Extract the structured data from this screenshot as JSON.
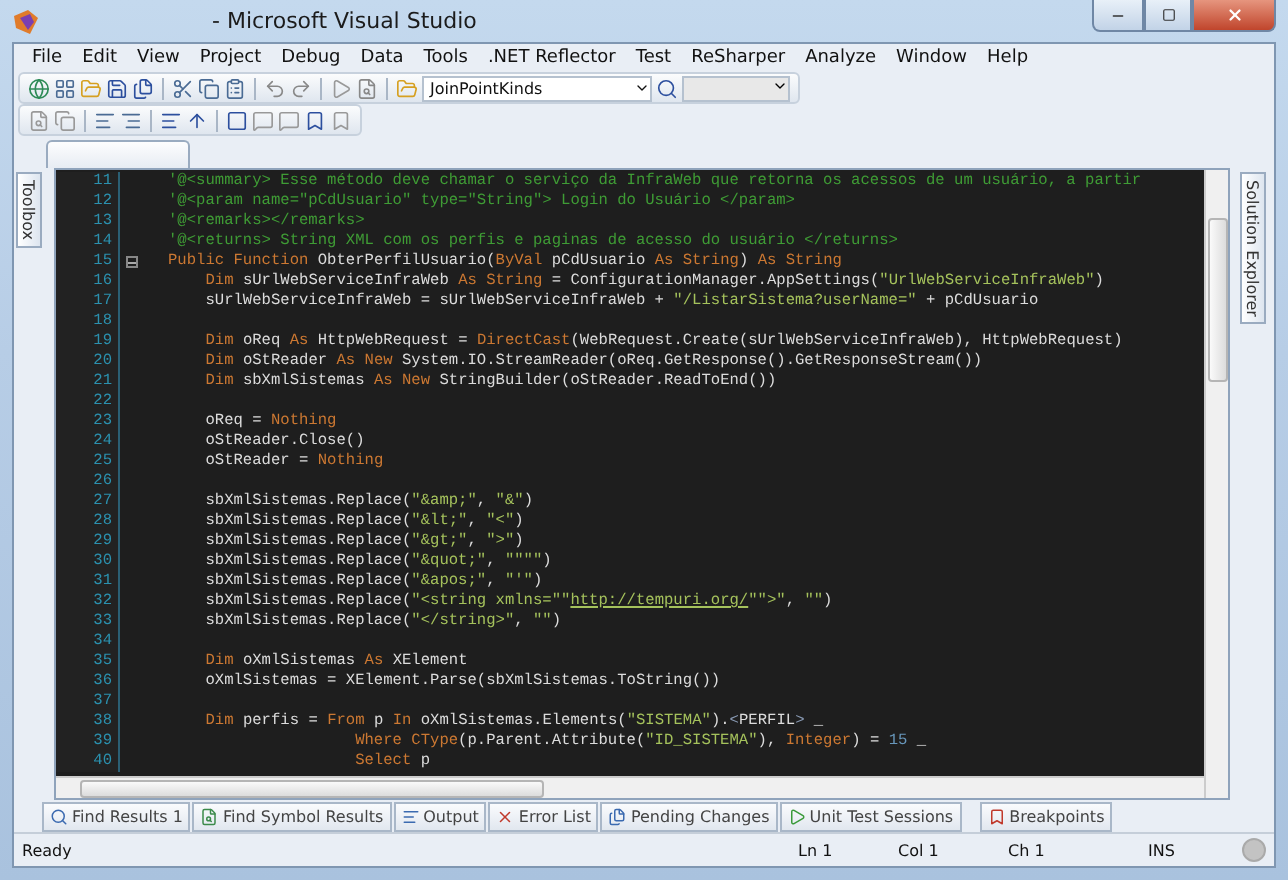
{
  "window": {
    "title": "- Microsoft Visual Studio"
  },
  "menu": [
    {
      "label": "File"
    },
    {
      "label": "Edit"
    },
    {
      "label": "View"
    },
    {
      "label": "Project"
    },
    {
      "label": "Debug"
    },
    {
      "label": "Data"
    },
    {
      "label": "Tools"
    },
    {
      "label": ".NET Reflector"
    },
    {
      "label": "Test"
    },
    {
      "label": "ReSharper"
    },
    {
      "label": "Analyze"
    },
    {
      "label": "Window"
    },
    {
      "label": "Help"
    }
  ],
  "toolbar": {
    "find_combo": {
      "value": "JoinPointKinds"
    }
  },
  "left_dock": {
    "label": "Toolbox"
  },
  "right_dock": {
    "label": "Solution Explorer"
  },
  "editor": {
    "lines": [
      {
        "number": "11",
        "fold": false,
        "tokens": [
          {
            "kind": "comment",
            "text": "'@<summary> Esse método deve chamar o serviço da InfraWeb que retorna os acessos de um usuário, a partir"
          }
        ]
      },
      {
        "number": "12",
        "fold": false,
        "tokens": [
          {
            "kind": "comment",
            "text": "'@<param name=\"pCdUsuario\" type=\"String\"> Login do Usuário </param>"
          }
        ]
      },
      {
        "number": "13",
        "fold": false,
        "tokens": [
          {
            "kind": "comment",
            "text": "'@<remarks></remarks>"
          }
        ]
      },
      {
        "number": "14",
        "fold": false,
        "tokens": [
          {
            "kind": "comment",
            "text": "'@<returns> String XML com os perfis e paginas de acesso do usuário </returns>"
          }
        ]
      },
      {
        "number": "15",
        "fold": true,
        "tokens": [
          {
            "kind": "keyword",
            "text": "Public Function"
          },
          {
            "kind": "plain",
            "text": " ObterPerfilUsuario("
          },
          {
            "kind": "keyword",
            "text": "ByVal"
          },
          {
            "kind": "plain",
            "text": " pCdUsuario "
          },
          {
            "kind": "keyword",
            "text": "As String"
          },
          {
            "kind": "plain",
            "text": ") "
          },
          {
            "kind": "keyword",
            "text": "As String"
          }
        ]
      },
      {
        "number": "16",
        "fold": false,
        "tokens": [
          {
            "kind": "keyword",
            "text": "    Dim"
          },
          {
            "kind": "plain",
            "text": " sUrlWebServiceInfraWeb "
          },
          {
            "kind": "keyword",
            "text": "As String"
          },
          {
            "kind": "plain",
            "text": " = ConfigurationManager.AppSettings("
          },
          {
            "kind": "string",
            "text": "\"UrlWebServiceInfraWeb\""
          },
          {
            "kind": "plain",
            "text": ")"
          }
        ]
      },
      {
        "number": "17",
        "fold": false,
        "tokens": [
          {
            "kind": "plain",
            "text": "    sUrlWebServiceInfraWeb = sUrlWebServiceInfraWeb + "
          },
          {
            "kind": "string",
            "text": "\"/ListarSistema?userName=\""
          },
          {
            "kind": "plain",
            "text": " + pCdUsuario"
          }
        ]
      },
      {
        "number": "18",
        "fold": false
      },
      {
        "number": "19",
        "fold": false,
        "tokens": [
          {
            "kind": "keyword",
            "text": "    Dim"
          },
          {
            "kind": "plain",
            "text": " oReq "
          },
          {
            "kind": "keyword",
            "text": "As"
          },
          {
            "kind": "plain",
            "text": " HttpWebRequest = "
          },
          {
            "kind": "keyword",
            "text": "DirectCast"
          },
          {
            "kind": "plain",
            "text": "(WebRequest.Create(sUrlWebServiceInfraWeb), HttpWebRequest)"
          }
        ]
      },
      {
        "number": "20",
        "fold": false,
        "tokens": [
          {
            "kind": "keyword",
            "text": "    Dim"
          },
          {
            "kind": "plain",
            "text": " oStReader "
          },
          {
            "kind": "keyword",
            "text": "As New"
          },
          {
            "kind": "plain",
            "text": " System.IO.StreamReader(oReq.GetResponse().GetResponseStream())"
          }
        ]
      },
      {
        "number": "21",
        "fold": false,
        "tokens": [
          {
            "kind": "keyword",
            "text": "    Dim"
          },
          {
            "kind": "plain",
            "text": " sbXmlSistemas "
          },
          {
            "kind": "keyword",
            "text": "As New"
          },
          {
            "kind": "plain",
            "text": " StringBuilder(oStReader.ReadToEnd())"
          }
        ]
      },
      {
        "number": "22",
        "fold": false
      },
      {
        "number": "23",
        "fold": false,
        "tokens": [
          {
            "kind": "plain",
            "text": "    oReq = "
          },
          {
            "kind": "keyword",
            "text": "Nothing"
          }
        ]
      },
      {
        "number": "24",
        "fold": false,
        "tokens": [
          {
            "kind": "plain",
            "text": "    oStReader.Close()"
          }
        ]
      },
      {
        "number": "25",
        "fold": false,
        "tokens": [
          {
            "kind": "plain",
            "text": "    oStReader = "
          },
          {
            "kind": "keyword",
            "text": "Nothing"
          }
        ]
      },
      {
        "number": "26",
        "fold": false
      },
      {
        "number": "27",
        "fold": false,
        "tokens": [
          {
            "kind": "plain",
            "text": "    sbXmlSistemas.Replace("
          },
          {
            "kind": "string",
            "text": "\"&amp;\""
          },
          {
            "kind": "plain",
            "text": ", "
          },
          {
            "kind": "string",
            "text": "\"&\""
          },
          {
            "kind": "plain",
            "text": ")"
          }
        ]
      },
      {
        "number": "28",
        "fold": false,
        "tokens": [
          {
            "kind": "plain",
            "text": "    sbXmlSistemas.Replace("
          },
          {
            "kind": "string",
            "text": "\"&lt;\""
          },
          {
            "kind": "plain",
            "text": ", "
          },
          {
            "kind": "string",
            "text": "\"<\""
          },
          {
            "kind": "plain",
            "text": ")"
          }
        ]
      },
      {
        "number": "29",
        "fold": false,
        "tokens": [
          {
            "kind": "plain",
            "text": "    sbXmlSistemas.Replace("
          },
          {
            "kind": "string",
            "text": "\"&gt;\""
          },
          {
            "kind": "plain",
            "text": ", "
          },
          {
            "kind": "string",
            "text": "\">\""
          },
          {
            "kind": "plain",
            "text": ")"
          }
        ]
      },
      {
        "number": "30",
        "fold": false,
        "tokens": [
          {
            "kind": "plain",
            "text": "    sbXmlSistemas.Replace("
          },
          {
            "kind": "string",
            "text": "\"&quot;\""
          },
          {
            "kind": "plain",
            "text": ", "
          },
          {
            "kind": "string",
            "text": "\"\"\"\""
          },
          {
            "kind": "plain",
            "text": ")"
          }
        ]
      },
      {
        "number": "31",
        "fold": false,
        "tokens": [
          {
            "kind": "plain",
            "text": "    sbXmlSistemas.Replace("
          },
          {
            "kind": "string",
            "text": "\"&apos;\""
          },
          {
            "kind": "plain",
            "text": ", "
          },
          {
            "kind": "string",
            "text": "\"'\""
          },
          {
            "kind": "plain",
            "text": ")"
          }
        ]
      },
      {
        "number": "32",
        "fold": false,
        "tokens": [
          {
            "kind": "plain",
            "text": "    sbXmlSistemas.Replace("
          },
          {
            "kind": "string",
            "text": "\"<string xmlns=\"\""
          },
          {
            "kind": "link",
            "text": "http://tempuri.org/"
          },
          {
            "kind": "string",
            "text": "\"\">\""
          },
          {
            "kind": "plain",
            "text": ", "
          },
          {
            "kind": "string",
            "text": "\"\""
          },
          {
            "kind": "plain",
            "text": ")"
          }
        ]
      },
      {
        "number": "33",
        "fold": false,
        "tokens": [
          {
            "kind": "plain",
            "text": "    sbXmlSistemas.Replace("
          },
          {
            "kind": "string",
            "text": "\"</string>\""
          },
          {
            "kind": "plain",
            "text": ", "
          },
          {
            "kind": "string",
            "text": "\"\""
          },
          {
            "kind": "plain",
            "text": ")"
          }
        ]
      },
      {
        "number": "34",
        "fold": false
      },
      {
        "number": "35",
        "fold": false,
        "tokens": [
          {
            "kind": "keyword",
            "text": "    Dim"
          },
          {
            "kind": "plain",
            "text": " oXmlSistemas "
          },
          {
            "kind": "keyword",
            "text": "As"
          },
          {
            "kind": "plain",
            "text": " XElement"
          }
        ]
      },
      {
        "number": "36",
        "fold": false,
        "tokens": [
          {
            "kind": "plain",
            "text": "    oXmlSistemas = XElement.Parse(sbXmlSistemas.ToString())"
          }
        ]
      },
      {
        "number": "37",
        "fold": false
      },
      {
        "number": "38",
        "fold": false,
        "tokens": [
          {
            "kind": "keyword",
            "text": "    Dim"
          },
          {
            "kind": "plain",
            "text": " perfis = "
          },
          {
            "kind": "keyword",
            "text": "From"
          },
          {
            "kind": "plain",
            "text": " p "
          },
          {
            "kind": "keyword",
            "text": "In"
          },
          {
            "kind": "plain",
            "text": " oXmlSistemas.Elements("
          },
          {
            "kind": "string",
            "text": "\"SISTEMA\""
          },
          {
            "kind": "plain",
            "text": ")."
          },
          {
            "kind": "xml",
            "text": "<"
          },
          {
            "kind": "plain",
            "text": "PERFIL"
          },
          {
            "kind": "xml",
            "text": ">"
          },
          {
            "kind": "plain",
            "text": " _"
          }
        ]
      },
      {
        "number": "39",
        "fold": false,
        "tokens": [
          {
            "kind": "keyword",
            "text": "                    Where CType"
          },
          {
            "kind": "plain",
            "text": "(p.Parent.Attribute("
          },
          {
            "kind": "string",
            "text": "\"ID_SISTEMA\""
          },
          {
            "kind": "plain",
            "text": "), "
          },
          {
            "kind": "keyword",
            "text": "Integer"
          },
          {
            "kind": "plain",
            "text": ") = "
          },
          {
            "kind": "number",
            "text": "15"
          },
          {
            "kind": "plain",
            "text": " _"
          }
        ]
      },
      {
        "number": "40",
        "fold": false,
        "tokens": [
          {
            "kind": "keyword",
            "text": "                    Select"
          },
          {
            "kind": "plain",
            "text": " p"
          }
        ]
      }
    ]
  },
  "tool_tabs": [
    {
      "label": "Find Results 1",
      "kind": "find"
    },
    {
      "label": "Find Symbol Results",
      "kind": "symbol"
    },
    {
      "label": "Output",
      "kind": "output"
    },
    {
      "label": "Error List",
      "kind": "error"
    },
    {
      "label": "Pending Changes",
      "kind": "pending"
    },
    {
      "label": "Unit Test Sessions",
      "kind": "test"
    },
    {
      "label": "Breakpoints",
      "kind": "breakpoint"
    }
  ],
  "status_bar": {
    "message": "Ready",
    "line": "Ln 1",
    "column": "Col 1",
    "char": "Ch 1",
    "mode": "INS"
  }
}
